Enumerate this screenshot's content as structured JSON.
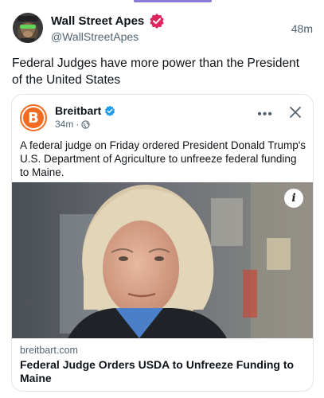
{
  "post": {
    "author_name": "Wall Street Apes",
    "author_handle": "@WallStreetApes",
    "time": "48m",
    "text": "Federal Judges have more power than the President of the United States"
  },
  "embed": {
    "source_name": "Breitbart",
    "source_logo_letter": "B",
    "meta_time": "34m",
    "meta_separator": "·",
    "more_icon": "•••",
    "text": "A federal judge on Friday ordered President Donald Trump's U.S. Department of Agriculture to unfreeze federal funding to Maine.",
    "info_label": "i",
    "link_domain": "breitbart.com",
    "link_title": "Federal Judge Orders USDA to Unfreeze Funding to Maine"
  },
  "colors": {
    "accent_top": "#8b7bd8",
    "verified_badge_main": "#e0245e",
    "verified_badge_source": "#1d9bf0",
    "breitbart_orange": "#f26b21"
  },
  "icons": [
    "verified-badge-icon",
    "globe-icon",
    "more-icon",
    "close-icon",
    "info-icon"
  ]
}
